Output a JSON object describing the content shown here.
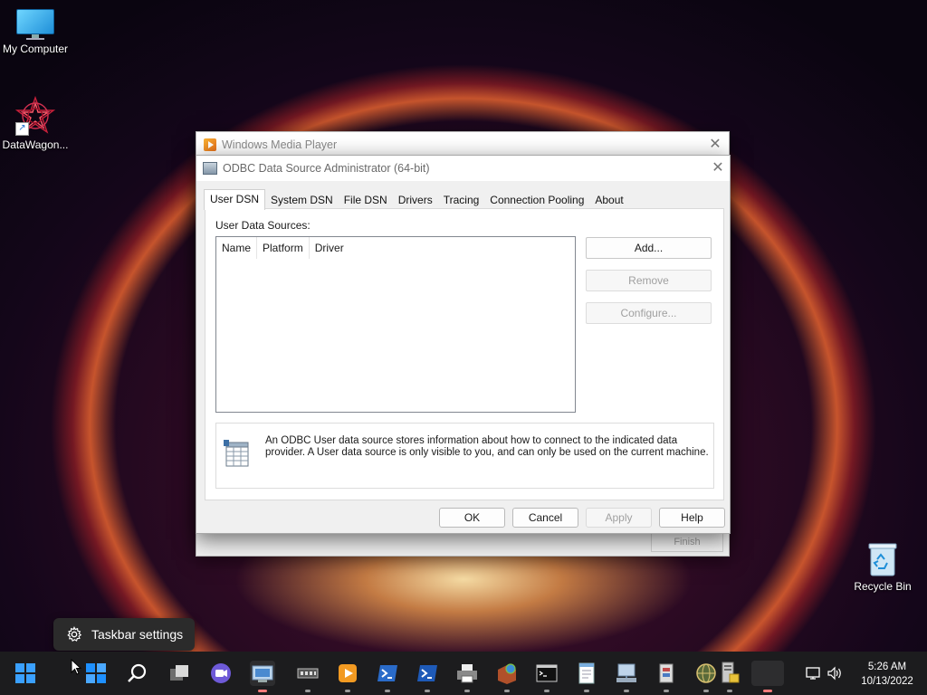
{
  "desktop": {
    "icons": [
      {
        "label": "My Computer"
      },
      {
        "label": "DataWagon..."
      },
      {
        "label": "Recycle Bin"
      }
    ]
  },
  "wmp_window": {
    "title": "Windows Media Player",
    "finish_label": "Finish"
  },
  "odbc_window": {
    "title": "ODBC Data Source Administrator (64-bit)",
    "tabs": [
      {
        "label": "User DSN",
        "active": true
      },
      {
        "label": "System DSN"
      },
      {
        "label": "File DSN"
      },
      {
        "label": "Drivers"
      },
      {
        "label": "Tracing"
      },
      {
        "label": "Connection Pooling"
      },
      {
        "label": "About"
      }
    ],
    "section_label": "User Data Sources:",
    "columns": [
      "Name",
      "Platform",
      "Driver"
    ],
    "rows": [],
    "side_buttons": {
      "add": "Add...",
      "remove": "Remove",
      "configure": "Configure..."
    },
    "info_text": "An ODBC User data source stores information about how to connect to the indicated data provider.   A User data source is only visible to you, and can only be used on the current machine.",
    "footer_buttons": {
      "ok": "OK",
      "cancel": "Cancel",
      "apply": "Apply",
      "help": "Help"
    }
  },
  "tooltip": {
    "label": "Taskbar settings"
  },
  "taskbar": {
    "icons": [
      "windows-start-icon",
      "search-icon",
      "task-view-icon",
      "chat-icon",
      "odbc-app-icon",
      "memory-chip-icon",
      "media-player-icon",
      "powershell-icon",
      "powershell-alt-icon",
      "printer-icon",
      "network-box-icon",
      "command-prompt-icon",
      "notepad-icon",
      "network-computer-icon",
      "registry-icon",
      "globe-icon",
      "server-icon"
    ]
  },
  "tray": {
    "time": "5:26 AM",
    "date": "10/13/2022"
  },
  "colors": {
    "taskbar": "#1c1c1e",
    "accent": "#0078d4",
    "disabled_text": "#a0a0a0"
  }
}
